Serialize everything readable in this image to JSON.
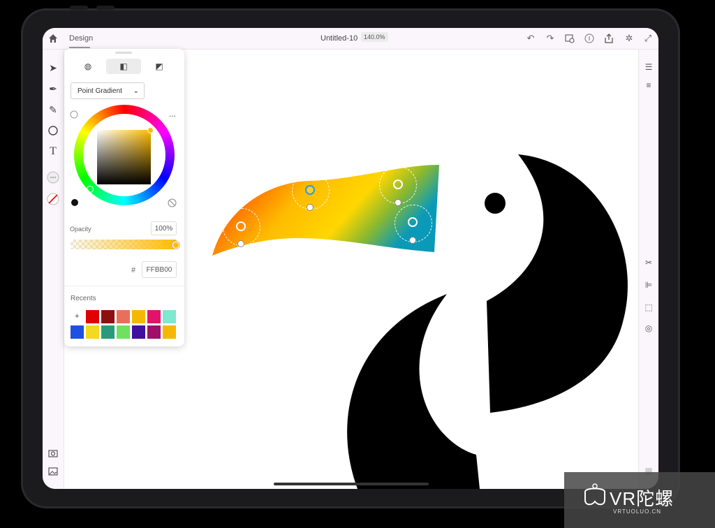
{
  "topbar": {
    "tab_label": "Design",
    "document_title": "Untitled-10",
    "zoom": "140.0%",
    "icons": [
      "home-icon",
      "undo-icon",
      "redo-icon",
      "cloud-sync-icon",
      "info-icon",
      "share-icon",
      "settings-icon",
      "expand-icon"
    ]
  },
  "left_tools": [
    "select-arrow-icon",
    "pen-icon",
    "pencil-icon",
    "ellipse-icon",
    "text-icon",
    "more-icon",
    "stroke-color-icon",
    "camera-icon",
    "image-import-icon"
  ],
  "right_tools": [
    "layers-icon",
    "properties-icon",
    "scissors-icon",
    "align-icon",
    "transform-icon",
    "combine-icon",
    "grid-icon"
  ],
  "color_panel": {
    "tabs": [
      "color-palette-tab",
      "gradient-tab",
      "swatches-tab"
    ],
    "gradient_type": "Point Gradient",
    "more_label": "...",
    "opacity_label": "Opacity",
    "opacity_value": "100%",
    "hash": "#",
    "hex_value": "FFBB00",
    "recents_label": "Recents",
    "add_label": "+",
    "recent_colors": [
      "#e00000",
      "#8b1010",
      "#e8705a",
      "#f5b800",
      "#e0156a",
      "#7fe8d0",
      "#2050e0",
      "#f5d820",
      "#2a9a7a",
      "#70e060",
      "#4010a0",
      "#a0106a",
      "#f5b800"
    ]
  },
  "colors": {
    "accent_blue": "#1fa0d8",
    "gradient_stops": [
      "#e60000",
      "#ff6a00",
      "#ffbb00",
      "#ffd700",
      "#8ab830",
      "#0a9ab8"
    ]
  },
  "watermark": {
    "brand": "VR陀螺",
    "site": "VRTUOLUO.CN"
  }
}
